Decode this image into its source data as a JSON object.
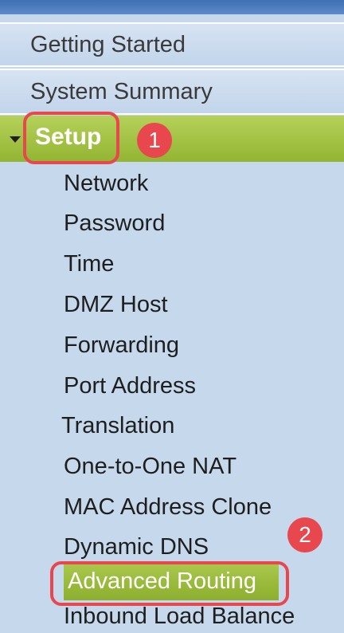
{
  "nav": {
    "getting_started": "Getting Started",
    "system_summary": "System Summary",
    "setup": "Setup"
  },
  "setup_items": [
    "Network",
    "Password",
    "Time",
    "DMZ Host",
    "Forwarding",
    "Port Address",
    "Translation",
    "One-to-One NAT",
    "MAC Address Clone",
    "Dynamic DNS",
    "Advanced Routing",
    "Inbound Load Balance"
  ],
  "annotations": {
    "step_1": "1",
    "step_2": "2"
  },
  "colors": {
    "active_green": "#9fc13f",
    "annotation_red": "#e8474e",
    "sidebar_bg": "#c6d8ec"
  },
  "icons": {
    "setup_expand": "triangle-down-icon"
  }
}
